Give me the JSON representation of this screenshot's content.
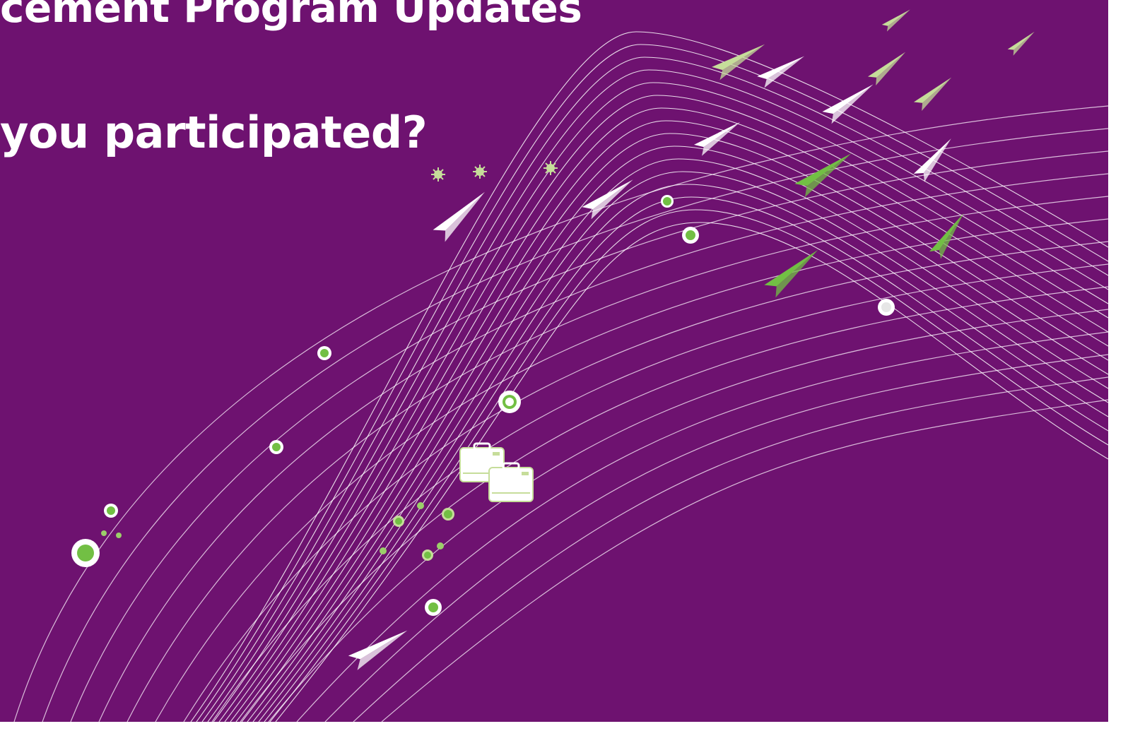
{
  "slide": {
    "title": "cement Program Updates",
    "subtitle": "you participated?"
  },
  "colors": {
    "background": "#6e1270",
    "text": "#ffffff",
    "accent_green": "#72bf44",
    "light_green": "#c6dd9a",
    "line": "#e6cfe6"
  },
  "decorations": {
    "icons": [
      "paper-plane-icon",
      "briefcase-icon",
      "dot-icon",
      "sparkle-icon"
    ]
  }
}
